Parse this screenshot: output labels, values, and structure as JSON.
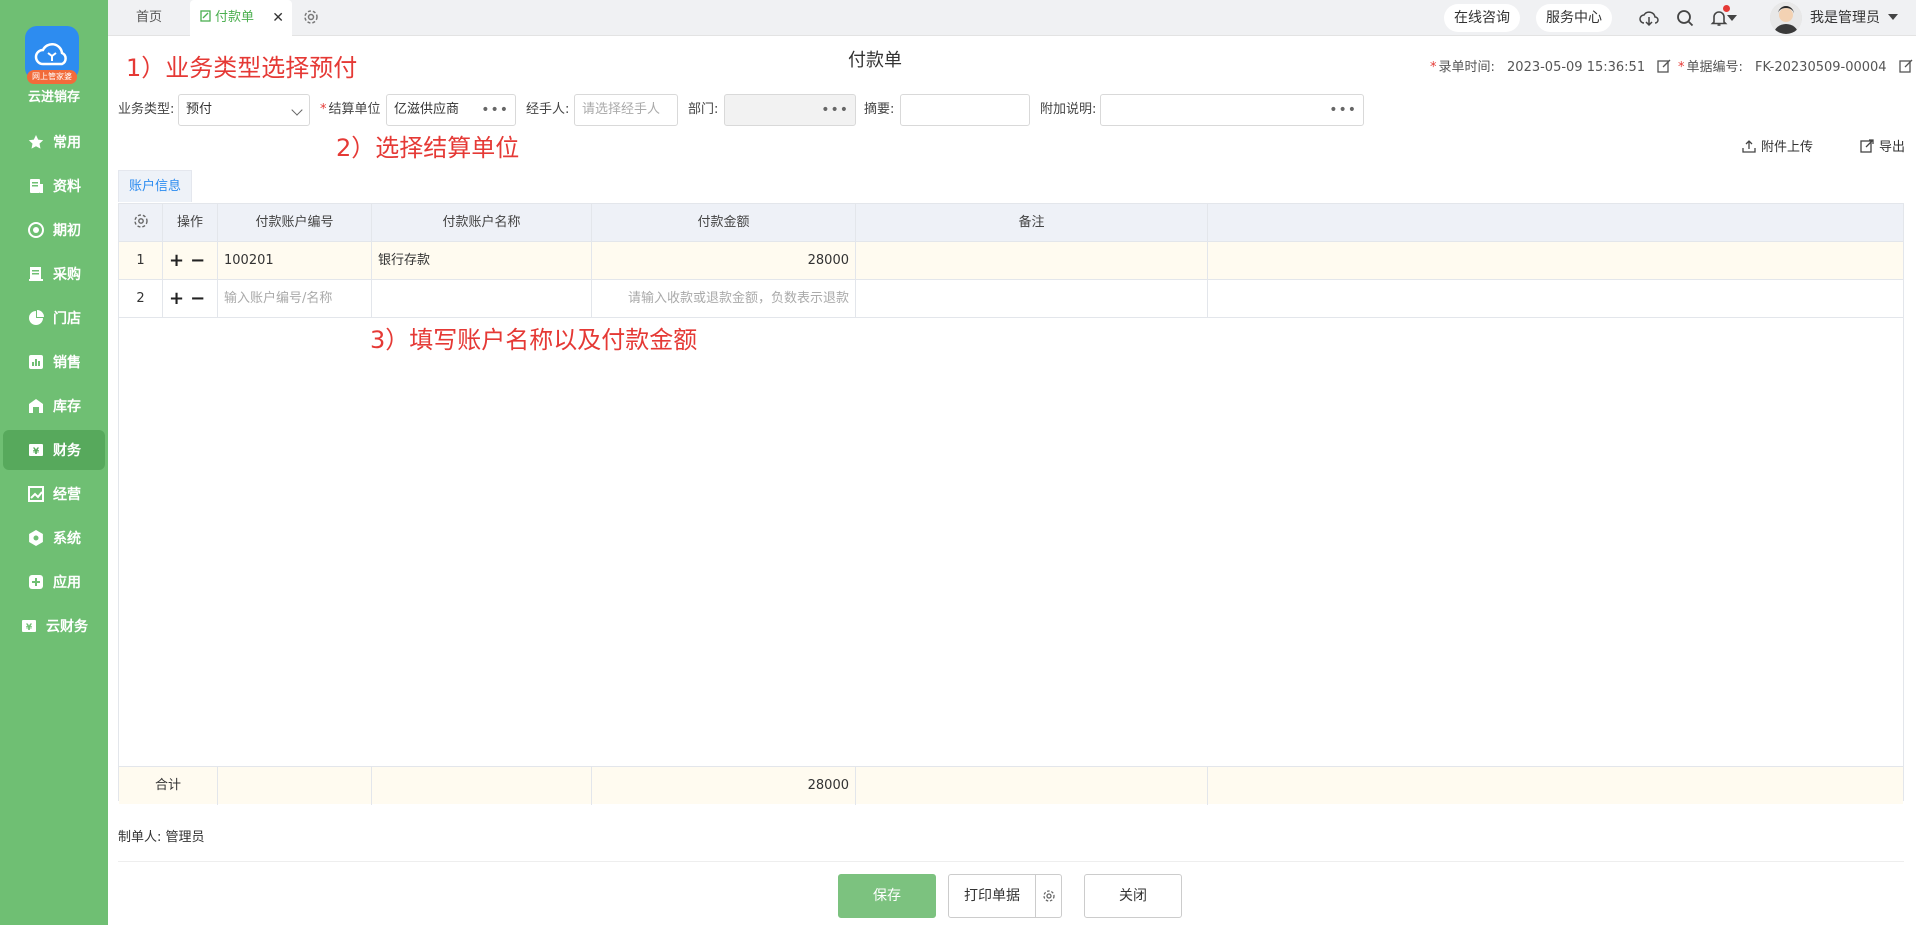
{
  "sidebar": {
    "brand": "云进销存",
    "logo_badge": "网上管家婆",
    "items": [
      {
        "label": "常用",
        "icon": "star-icon"
      },
      {
        "label": "资料",
        "icon": "document-icon"
      },
      {
        "label": "期初",
        "icon": "target-icon"
      },
      {
        "label": "采购",
        "icon": "purchase-icon"
      },
      {
        "label": "门店",
        "icon": "pie-icon"
      },
      {
        "label": "销售",
        "icon": "chart-icon"
      },
      {
        "label": "库存",
        "icon": "warehouse-icon"
      },
      {
        "label": "财务",
        "icon": "finance-icon"
      },
      {
        "label": "经营",
        "icon": "trend-icon"
      },
      {
        "label": "系统",
        "icon": "gear-icon"
      },
      {
        "label": "应用",
        "icon": "plus-icon"
      },
      {
        "label": "云财务",
        "icon": "cloud-finance-icon"
      }
    ],
    "active_index": 7
  },
  "topbar": {
    "home_tab": "首页",
    "active_tab": "付款单",
    "close_glyph": "✕",
    "online_consult": "在线咨询",
    "service_center": "服务中心",
    "user_name": "我是管理员"
  },
  "annotations": {
    "step1": "1）业务类型选择预付",
    "step2": "2）选择结算单位",
    "step3": "3）填写账户名称以及付款金额"
  },
  "form": {
    "title": "付款单",
    "entry_time_label": "录单时间:",
    "entry_time": "2023-05-09 15:36:51",
    "doc_no_label": "单据编号:",
    "doc_no": "FK-20230509-00004",
    "business_type_label": "业务类型:",
    "business_type": "预付",
    "settle_unit_label": "结算单位",
    "settle_unit": "亿滋供应商",
    "handler_label": "经手人:",
    "handler_placeholder": "请选择经手人",
    "dept_label": "部门:",
    "summary_label": "摘要:",
    "extra_label": "附加说明:",
    "dots": "•••",
    "attach_upload": "附件上传",
    "export": "导出",
    "sub_tab": "账户信息"
  },
  "table": {
    "headers": [
      "操作",
      "付款账户编号",
      "付款账户名称",
      "付款金额",
      "备注"
    ],
    "rows": [
      {
        "index": "1",
        "code": "100201",
        "name": "银行存款",
        "amount": "28000",
        "remark": ""
      },
      {
        "index": "2",
        "code_placeholder": "输入账户编号/名称",
        "name": "",
        "amount_placeholder": "请输入收款或退款金额，负数表示退款",
        "remark": ""
      }
    ],
    "plus": "+",
    "minus": "−",
    "total_label": "合计",
    "total_amount": "28000"
  },
  "footer": {
    "maker_label": "制单人:",
    "maker": "管理员",
    "save": "保存",
    "print": "打印单据",
    "close": "关闭"
  },
  "colors": {
    "sidebar": "#6fbf73",
    "accent": "#4caf50",
    "annotation": "#e53935",
    "link": "#2d8cf0"
  }
}
